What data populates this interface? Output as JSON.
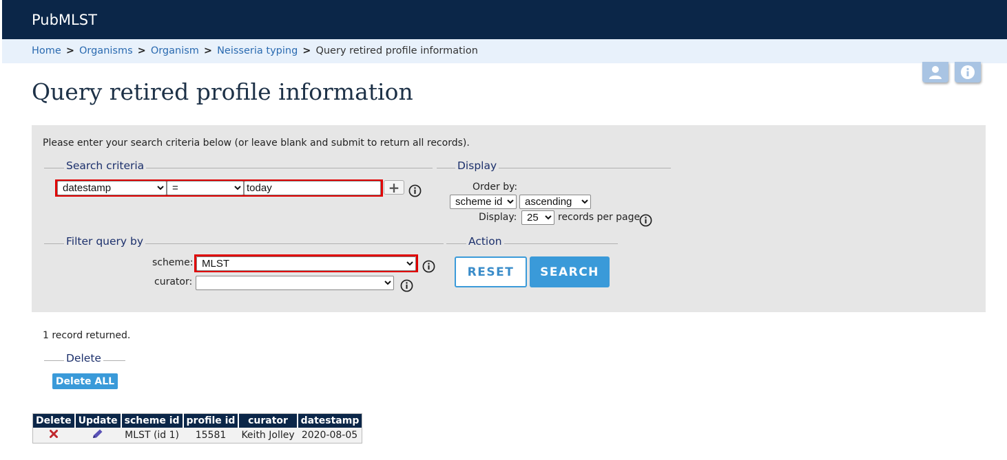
{
  "header": {
    "site_title": "PubMLST"
  },
  "breadcrumb": {
    "items": [
      "Home",
      "Organisms",
      "Organism",
      "Neisseria typing"
    ],
    "separator": ">",
    "current": "Query retired profile information"
  },
  "corner_buttons": {
    "user_icon": "user-icon",
    "info_icon": "info-icon"
  },
  "page_title": "Query retired profile information",
  "query": {
    "intro": "Please enter your search criteria below (or leave blank and submit to return all records).",
    "search_criteria": {
      "legend": "Search criteria",
      "field_value": "datestamp",
      "operator_value": "=",
      "term_value": "today"
    },
    "display": {
      "legend": "Display",
      "order_by_label": "Order by:",
      "order_by_value": "scheme id",
      "direction_value": "ascending",
      "display_label": "Display:",
      "per_page_value": "25",
      "records_per_page_label": "records per page"
    },
    "filter": {
      "legend": "Filter query by",
      "scheme_label": "scheme:",
      "scheme_value": "MLST",
      "curator_label": "curator:",
      "curator_value": ""
    },
    "action": {
      "legend": "Action",
      "reset_label": "RESET",
      "search_label": "SEARCH"
    }
  },
  "results": {
    "count_text": "1 record returned.",
    "delete_legend": "Delete",
    "delete_all_label": "Delete ALL",
    "columns": [
      "Delete",
      "Update",
      "scheme id",
      "profile id",
      "curator",
      "datestamp"
    ],
    "rows": [
      {
        "scheme_id": "MLST (id 1)",
        "profile_id": "15581",
        "curator": "Keith Jolley",
        "datestamp": "2020-08-05"
      }
    ]
  },
  "colors": {
    "header_bg": "#0b2648",
    "breadcrumb_bg": "#e8f1fb",
    "accent": "#3a9ad9",
    "highlight": "#e00000"
  }
}
